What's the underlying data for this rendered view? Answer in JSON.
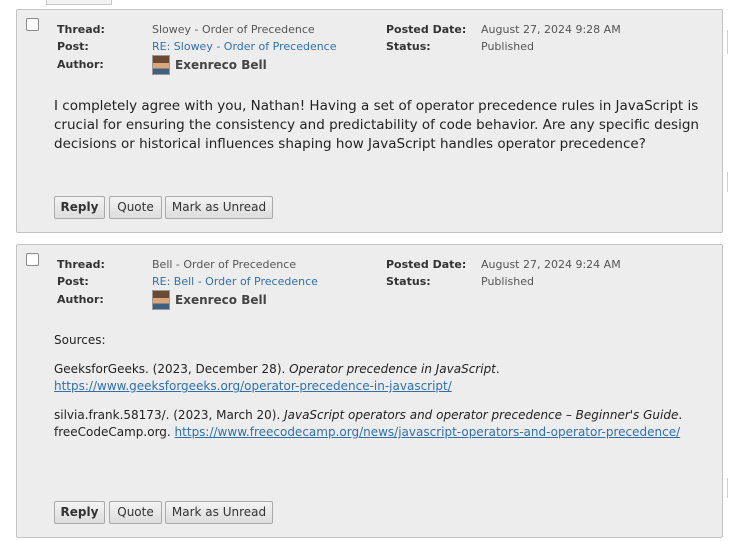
{
  "labels": {
    "thread": "Thread:",
    "post": "Post:",
    "author": "Author:",
    "posted_date": "Posted Date:",
    "status": "Status:"
  },
  "buttons": {
    "reply": "Reply",
    "quote": "Quote",
    "mark_unread": "Mark as Unread"
  },
  "posts": [
    {
      "thread": "Slowey - Order of Precedence",
      "post": "RE: Slowey - Order of Precedence",
      "author": "Exenreco Bell",
      "posted_date": "August 27, 2024 9:28 AM",
      "status": "Published",
      "body": "I completely agree with you, Nathan! Having a set of operator precedence rules in JavaScript is crucial for ensuring the consistency and predictability of code behavior. Are any specific design decisions or historical influences shaping how JavaScript handles operator precedence?"
    },
    {
      "thread": "Bell - Order of Precedence",
      "post": "RE: Bell - Order of Precedence",
      "author": "Exenreco Bell",
      "posted_date": "August 27, 2024 9:24 AM",
      "status": "Published",
      "sources_label": "Sources:",
      "ref1_prefix": "GeeksforGeeks. (2023, December 28). ",
      "ref1_title": "Operator precedence in JavaScript",
      "ref1_sep": ". ",
      "ref1_link": "https://www.geeksforgeeks.org/operator-precedence-in-javascript/",
      "ref2_prefix": "silvia.frank.58173/. (2023, March 20). ",
      "ref2_title": "JavaScript operators and operator precedence – Beginner's Guide",
      "ref2_mid": ". freeCodeCamp.org. ",
      "ref2_link": "https://www.freecodecamp.org/news/javascript-operators-and-operator-precedence/"
    }
  ]
}
